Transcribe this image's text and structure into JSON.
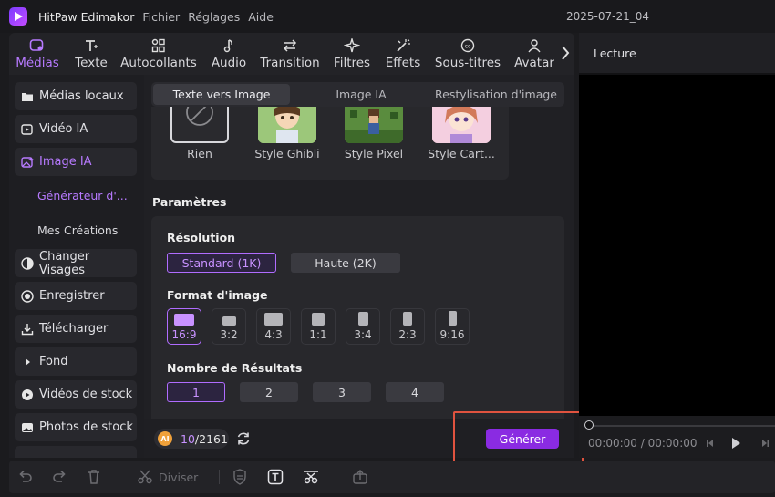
{
  "titlebar": {
    "app_title": "HitPaw Edimakor",
    "menus": [
      "Fichier",
      "Réglages",
      "Aide"
    ],
    "project_name": "2025-07-21_04"
  },
  "toolbar": {
    "tabs": [
      {
        "label": "Médias",
        "icon": "media-icon"
      },
      {
        "label": "Texte",
        "icon": "text-icon"
      },
      {
        "label": "Autocollants",
        "icon": "stickers-icon"
      },
      {
        "label": "Audio",
        "icon": "music-note-icon"
      },
      {
        "label": "Transition",
        "icon": "transition-arrows-icon"
      },
      {
        "label": "Filtres",
        "icon": "sparkle-icon"
      },
      {
        "label": "Effets",
        "icon": "effects-wand-icon"
      },
      {
        "label": "Sous-titres",
        "icon": "subtitles-icon"
      },
      {
        "label": "Avatar",
        "icon": "avatar-icon"
      }
    ]
  },
  "sidebar": {
    "items": [
      {
        "label": "Médias locaux"
      },
      {
        "label": "Vidéo IA"
      },
      {
        "label": "Image IA"
      },
      {
        "label": "Changer Visages"
      },
      {
        "label": "Enregistrer"
      },
      {
        "label": "Télécharger"
      },
      {
        "label": "Fond"
      },
      {
        "label": "Vidéos de stock"
      },
      {
        "label": "Photos de stock"
      }
    ],
    "subitems": [
      {
        "label": "Générateur d'..."
      },
      {
        "label": "Mes Créations"
      }
    ]
  },
  "panel": {
    "tabs": [
      {
        "label": "Texte vers Image"
      },
      {
        "label": "Image IA"
      },
      {
        "label": "Restylisation d'image"
      }
    ],
    "styles": [
      {
        "label": "Rien"
      },
      {
        "label": "Style Ghibli"
      },
      {
        "label": "Style Pixel"
      },
      {
        "label": "Style Cart..."
      }
    ],
    "params_title": "Paramètres",
    "resolution": {
      "title": "Résolution",
      "options": [
        "Standard (1K)",
        "Haute (2K)"
      ],
      "selected": "Standard (1K)"
    },
    "format": {
      "title": "Format d'image",
      "options": [
        "16:9",
        "3:2",
        "4:3",
        "1:1",
        "3:4",
        "2:3",
        "9:16"
      ],
      "selected": "16:9"
    },
    "results": {
      "title": "Nombre de Résultats",
      "options": [
        "1",
        "2",
        "3",
        "4"
      ],
      "selected": "1"
    },
    "credits": {
      "used": "10",
      "total": "/2161",
      "coin": "AI"
    },
    "generate_label": "Générer"
  },
  "preview": {
    "title": "Lecture",
    "current_time": "00:00:00",
    "separator": "/",
    "total_time": "00:00:00"
  },
  "bottombar": {
    "split_label": "Diviser"
  },
  "colors": {
    "accent": "#b77aff",
    "generate": "#8a2be2",
    "highlight": "#e0533f"
  }
}
